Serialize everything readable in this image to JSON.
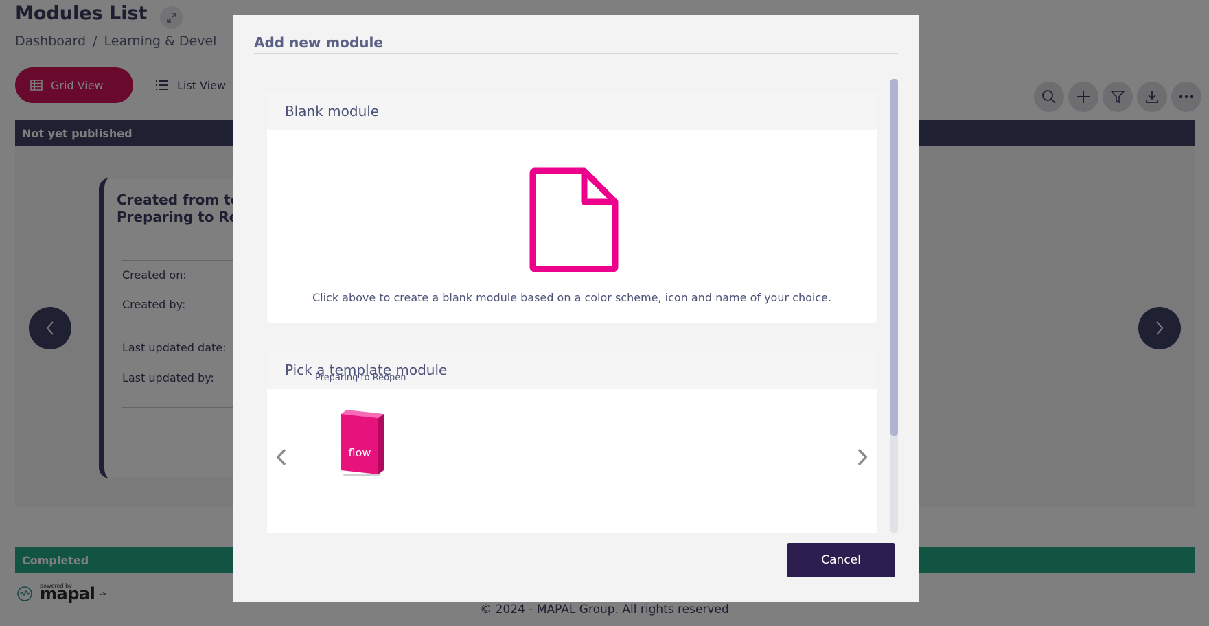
{
  "page": {
    "title": "Modules List",
    "breadcrumb": [
      "Dashboard",
      "/",
      "Learning & Devel"
    ],
    "view_buttons": {
      "grid": "Grid View",
      "list": "List View"
    }
  },
  "sections": {
    "unpublished": "Not yet published",
    "completed": "Completed"
  },
  "card": {
    "title_line1": "Created from te",
    "title_line2": "Preparing to Re",
    "created_on": "Created on:",
    "created_by": "Created by:",
    "last_updated_date": "Last updated date:",
    "last_updated_by": "Last updated by:"
  },
  "footer": {
    "powered_by": "powered by",
    "logo": "mapal",
    "logo_suffix": "os",
    "copyright": "© 2024 - MAPAL Group. All rights reserved"
  },
  "modal": {
    "title": "Add new module",
    "blank": {
      "heading": "Blank module",
      "description": "Click above to create a blank module based on a color scheme, icon and name of your choice."
    },
    "template": {
      "heading": "Pick a template module",
      "items": [
        {
          "name": "Preparing to Reopen",
          "box_label": "flow"
        }
      ]
    },
    "cancel": "Cancel"
  },
  "colors": {
    "accent": "#d2145a",
    "blank_icon": "#ec008c",
    "dark_navy": "#3e4266",
    "completed": "#21a883",
    "cancel_bg": "#2c1f4f"
  },
  "icons": {
    "expand": "expand-arrows-icon",
    "grid": "grid-icon",
    "list": "list-icon",
    "tools": [
      "search-icon",
      "plus-icon",
      "filter-icon",
      "download-icon",
      "more-icon"
    ],
    "blank": "document-icon"
  }
}
